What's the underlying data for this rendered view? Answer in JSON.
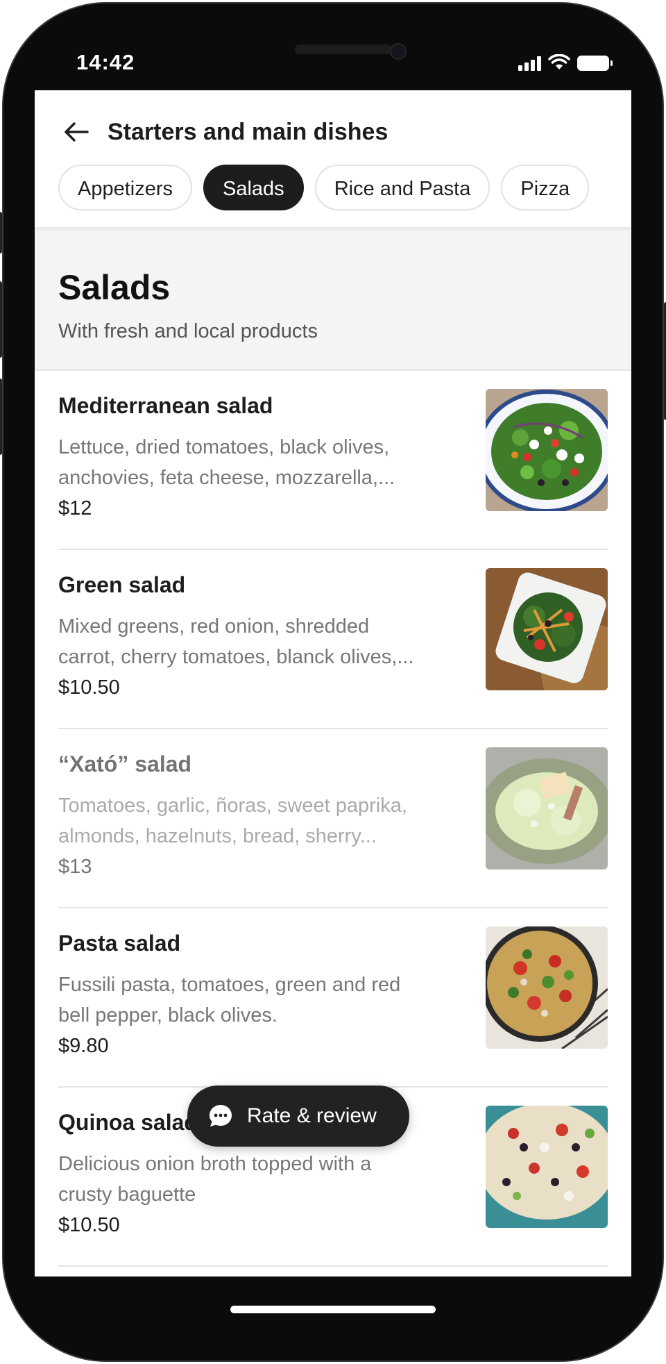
{
  "status_bar": {
    "time": "14:42"
  },
  "header": {
    "title": "Starters and main dishes"
  },
  "tabs": [
    {
      "label": "Appetizers",
      "active": false
    },
    {
      "label": "Salads",
      "active": true
    },
    {
      "label": "Rice and Pasta",
      "active": false
    },
    {
      "label": "Pizza",
      "active": false
    }
  ],
  "section": {
    "title": "Salads",
    "subtitle": "With fresh and local products"
  },
  "items": [
    {
      "name": "Mediterranean salad",
      "desc_line1": "Lettuce, dried tomatoes, black olives,",
      "desc_line2": "anchovies, feta cheese, mozzarella,...",
      "price": "$12",
      "image": "mediterranean-salad-photo",
      "unavailable": false
    },
    {
      "name": "Green salad",
      "desc_line1": "Mixed greens, red onion, shredded",
      "desc_line2": "carrot, cherry tomatoes, blanck olives,...",
      "price": "$10.50",
      "image": "green-salad-photo",
      "unavailable": false
    },
    {
      "name": "“Xató” salad",
      "desc_line1": "Tomatoes, garlic, ñoras, sweet paprika,",
      "desc_line2": "almonds, hazelnuts, bread, sherry...",
      "price": "$13",
      "image": "xato-salad-photo",
      "unavailable": true
    },
    {
      "name": "Pasta salad",
      "desc_line1": "Fussili pasta, tomatoes, green and red",
      "desc_line2": "bell pepper, black olives.",
      "price": "$9.80",
      "image": "pasta-salad-photo",
      "unavailable": false
    },
    {
      "name": "Quinoa salad",
      "desc_line1": "Delicious onion broth topped with a",
      "desc_line2": "crusty baguette",
      "price": "$10.50",
      "image": "quinoa-salad-photo",
      "unavailable": false
    }
  ],
  "fab": {
    "label": "Rate & review",
    "icon": "chat-bubble-icon"
  },
  "colors": {
    "accent": "#1d1d1d",
    "section_bg": "#f4f4f4"
  }
}
